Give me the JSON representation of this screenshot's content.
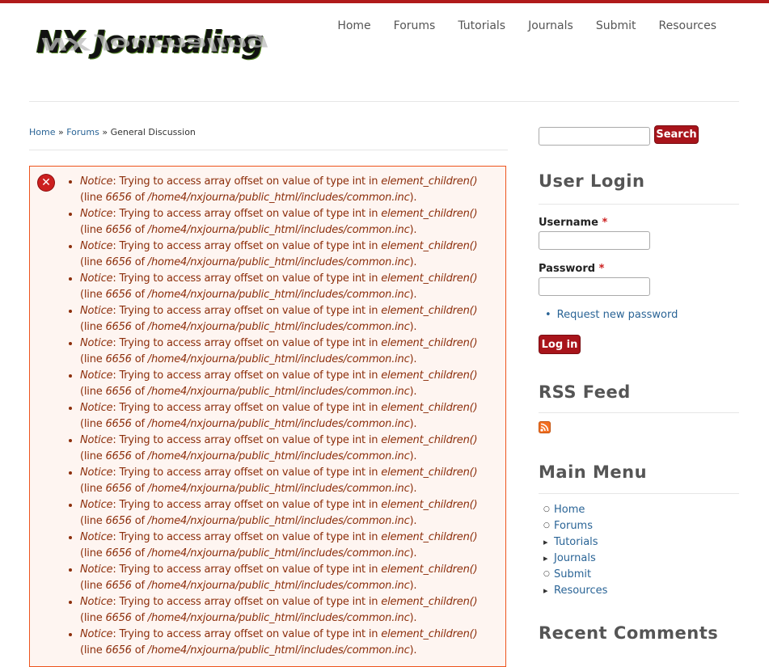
{
  "logo": {
    "text": "NX Journaling"
  },
  "nav": [
    "Home",
    "Forums",
    "Tutorials",
    "Journals",
    "Submit",
    "Resources"
  ],
  "breadcrumb": {
    "home": "Home",
    "forums": "Forums",
    "sep": "»",
    "current": "General Discussion"
  },
  "error_notice": {
    "label": "Notice",
    "message": ": Trying to access array offset on value of type int in ",
    "function": "element_children()",
    "line_prefix": " (line ",
    "line_number": "6656",
    "of_text": " of ",
    "file": "/home4/nxjourna/public_html/includes/common.inc",
    "suffix": ").",
    "count": 15
  },
  "sidebar": {
    "search_button": "Search",
    "user_login": {
      "title": "User Login",
      "username_label": "Username",
      "password_label": "Password",
      "required_mark": "*",
      "request_password": "Request new password",
      "login_button": "Log in"
    },
    "rss": {
      "title": "RSS Feed",
      "icon": "rss-icon"
    },
    "main_menu": {
      "title": "Main Menu",
      "items": [
        {
          "label": "Home",
          "marker": "circle"
        },
        {
          "label": "Forums",
          "marker": "circle"
        },
        {
          "label": "Tutorials",
          "marker": "triangle"
        },
        {
          "label": "Journals",
          "marker": "triangle"
        },
        {
          "label": "Submit",
          "marker": "circle"
        },
        {
          "label": "Resources",
          "marker": "triangle"
        }
      ]
    },
    "recent_comments": {
      "title": "Recent Comments"
    }
  },
  "colors": {
    "accent": "#a8141b",
    "link": "#2a6496",
    "error_border": "#ed541d",
    "error_bg": "#fef5f1",
    "error_text": "#8c2e0b"
  }
}
